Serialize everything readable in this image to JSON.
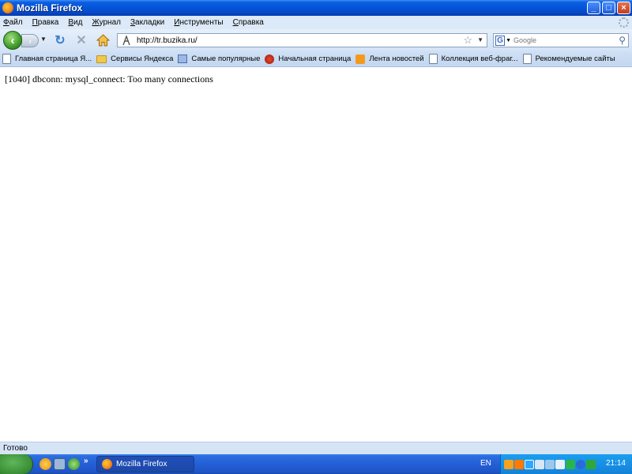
{
  "window": {
    "title": "Mozilla Firefox"
  },
  "menu": [
    {
      "label": "Файл",
      "accel": "Ф"
    },
    {
      "label": "Правка",
      "accel": "П"
    },
    {
      "label": "Вид",
      "accel": "В"
    },
    {
      "label": "Журнал",
      "accel": "Ж"
    },
    {
      "label": "Закладки",
      "accel": "З"
    },
    {
      "label": "Инструменты",
      "accel": "И"
    },
    {
      "label": "Справка",
      "accel": "С"
    }
  ],
  "navbar": {
    "url": "http://tr.buzika.ru/",
    "search_placeholder": "Google",
    "search_engine": "G"
  },
  "bookmarks": [
    {
      "label": "Главная страница Я...",
      "icon": "page-icon"
    },
    {
      "label": "Сервисы Яндекса",
      "icon": "folder-icon"
    },
    {
      "label": "Самые популярные",
      "icon": "smart-folder-icon"
    },
    {
      "label": "Начальная страница",
      "icon": "firefox-icon"
    },
    {
      "label": "Лента новостей",
      "icon": "rss-icon"
    },
    {
      "label": "Коллекция веб-фраг...",
      "icon": "page-icon"
    },
    {
      "label": "Рекомендуемые сайты",
      "icon": "page-icon"
    }
  ],
  "content": {
    "error_message": "[1040] dbconn: mysql_connect: Too many connections"
  },
  "statusbar": {
    "text": "Готово"
  },
  "taskbar": {
    "task_label": "Mozilla Firefox",
    "language": "EN",
    "clock": "21:14"
  }
}
